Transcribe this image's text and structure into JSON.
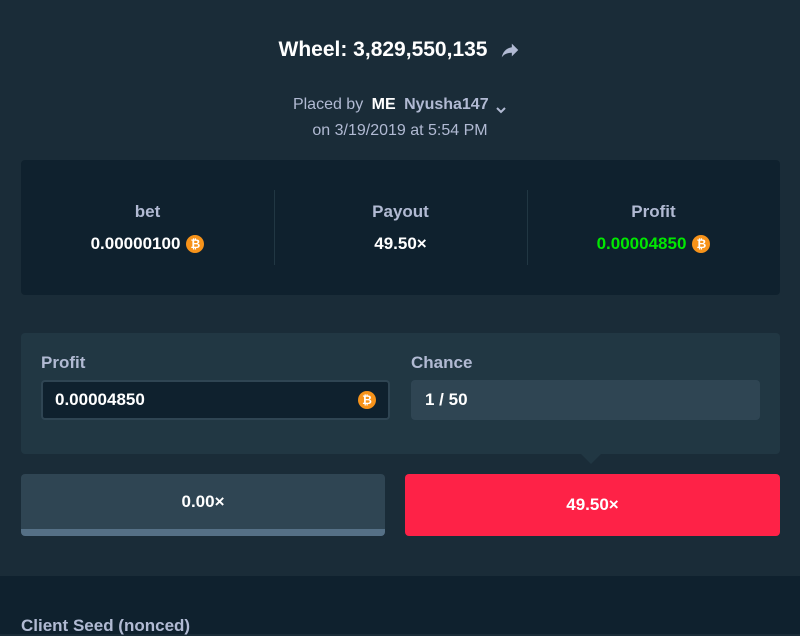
{
  "header": {
    "title": "Wheel: 3,829,550,135",
    "share_icon": "share-arrow-icon"
  },
  "placed": {
    "prefix": "Placed by",
    "me_tag": "ME",
    "username": "Nyusha147",
    "date_line": "on 3/19/2019 at 5:54 PM"
  },
  "stats": {
    "bet": {
      "label": "bet",
      "value": "0.00000100",
      "icon": "bitcoin-icon"
    },
    "payout": {
      "label": "Payout",
      "value": "49.50×"
    },
    "profit": {
      "label": "Profit",
      "value": "0.00004850",
      "icon": "bitcoin-icon",
      "color": "#00e701"
    }
  },
  "calculator": {
    "profit_label": "Profit",
    "profit_value": "0.00004850",
    "chance_label": "Chance",
    "chance_value": "1 / 50"
  },
  "segments": {
    "zero_label": "0.00×",
    "hit_label": "49.50×",
    "hit_color": "#fe2247"
  },
  "seed": {
    "client_seed_label": "Client Seed (nonced)"
  }
}
